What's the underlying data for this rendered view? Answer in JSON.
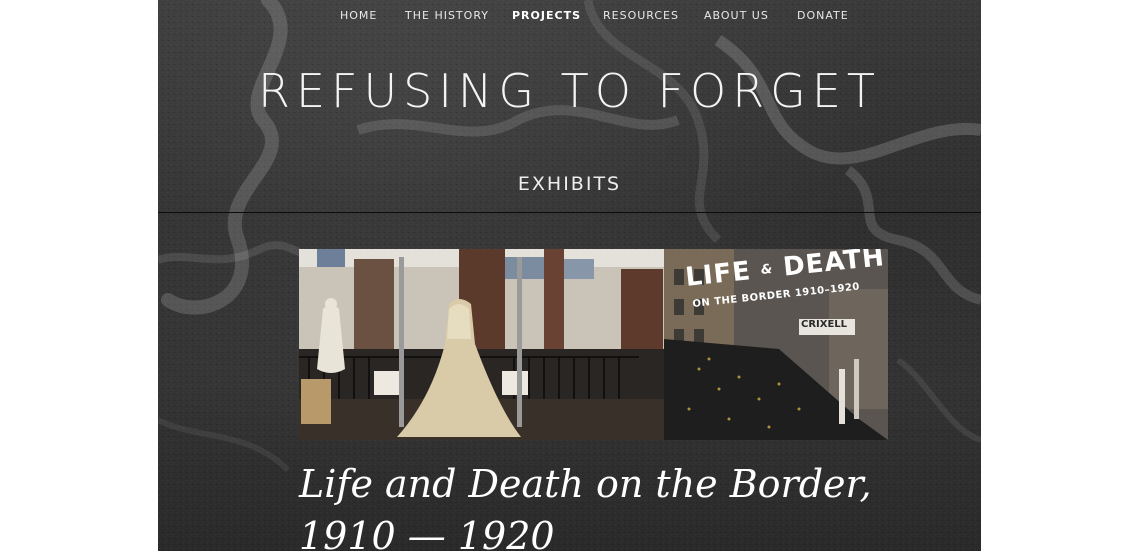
{
  "nav": {
    "items": [
      {
        "label": "HOME"
      },
      {
        "label": "THE HISTORY"
      },
      {
        "label": "PROJECTS"
      },
      {
        "label": "RESOURCES"
      },
      {
        "label": "ABOUT US"
      },
      {
        "label": "DONATE"
      }
    ],
    "active": "PROJECTS"
  },
  "site": {
    "title": "REFUSING TO FORGET"
  },
  "section": {
    "title": "EXHIBITS"
  },
  "hero": {
    "banner_line1": "LIFE",
    "banner_amp": "&",
    "banner_line2": "DEATH",
    "banner_subtitle": "ON THE BORDER 1910–1920",
    "sign_text": "CRIXELL"
  },
  "post": {
    "title_line1": "Life and Death on the Border,",
    "title_line2": "1910 — 1920"
  },
  "colors": {
    "background": "#333333",
    "text": "#ffffff",
    "rule": "#0c0c0c"
  }
}
